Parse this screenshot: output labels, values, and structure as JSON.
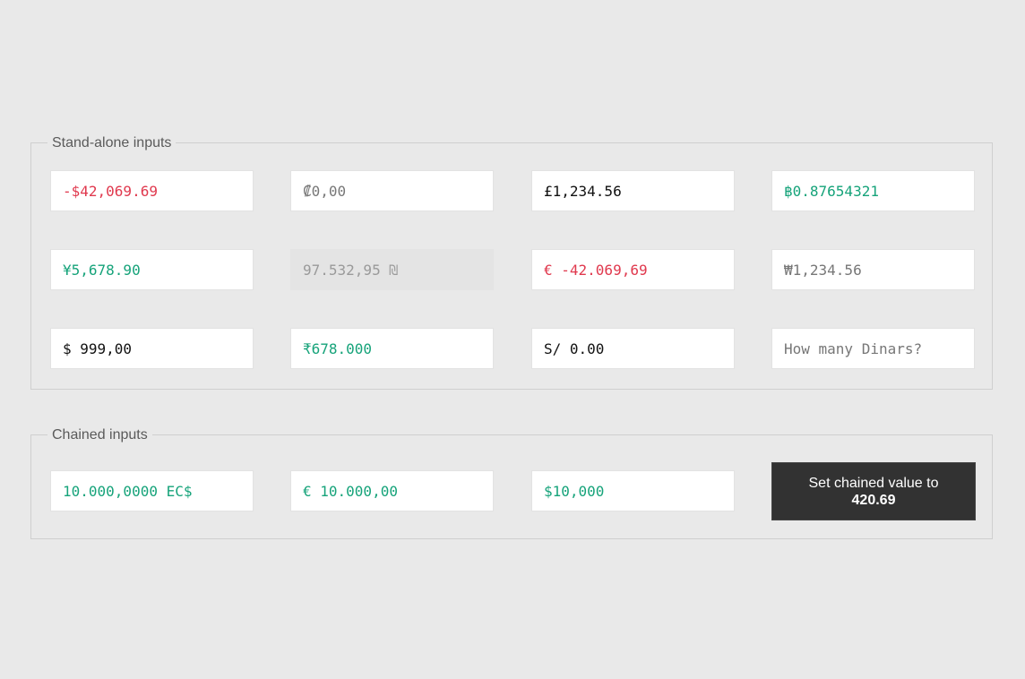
{
  "standalone": {
    "legend": "Stand-alone inputs",
    "inputs": [
      {
        "value": "-$42,069.69",
        "placeholder": "",
        "state": "negative"
      },
      {
        "value": "",
        "placeholder": "₡0,00",
        "state": "empty"
      },
      {
        "value": "£1,234.56",
        "placeholder": "",
        "state": "neutral"
      },
      {
        "value": "฿0.87654321",
        "placeholder": "",
        "state": "positive"
      },
      {
        "value": "¥5,678.90",
        "placeholder": "",
        "state": "positive"
      },
      {
        "value": "97.532,95 ₪",
        "placeholder": "",
        "state": "disabled"
      },
      {
        "value": "€ -42.069,69",
        "placeholder": "",
        "state": "negative"
      },
      {
        "value": "",
        "placeholder": "₩1,234.56",
        "state": "empty"
      },
      {
        "value": "$ 999,00",
        "placeholder": "",
        "state": "neutral"
      },
      {
        "value": "₹678.000",
        "placeholder": "",
        "state": "positive"
      },
      {
        "value": "S/ 0.00",
        "placeholder": "",
        "state": "neutral"
      },
      {
        "value": "",
        "placeholder": "How many Dinars?",
        "state": "empty"
      }
    ]
  },
  "chained": {
    "legend": "Chained inputs",
    "inputs": [
      {
        "value": "10.000,0000 EC$",
        "state": "positive"
      },
      {
        "value": "€ 10.000,00",
        "state": "positive"
      },
      {
        "value": "$10,000",
        "state": "positive"
      }
    ],
    "button": {
      "label_line1": "Set chained value to",
      "label_line2": "420.69"
    }
  },
  "colors": {
    "positive": "#16a37a",
    "negative": "#e0394e",
    "neutral": "#111111",
    "placeholder": "#777777",
    "button_bg": "#323232"
  }
}
